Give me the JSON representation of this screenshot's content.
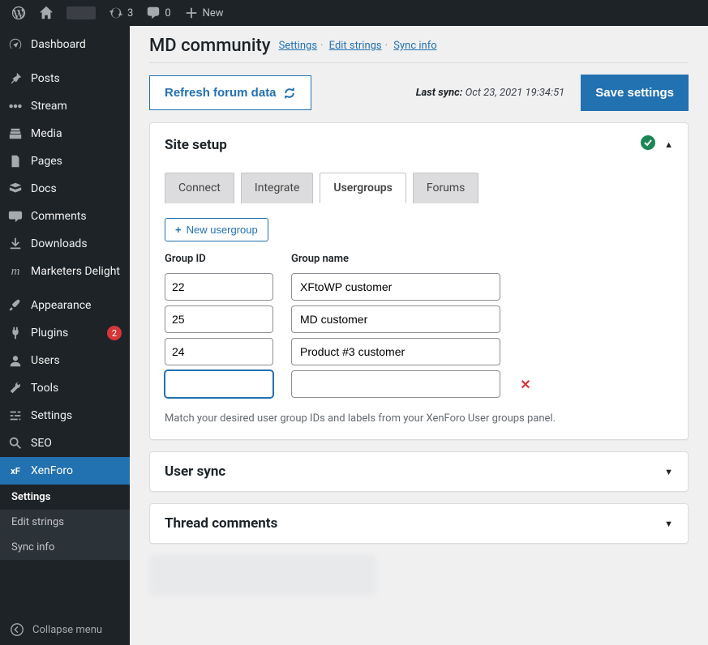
{
  "adminbar": {
    "update_count": "3",
    "comments_count": "0",
    "new_label": "New"
  },
  "sidebar": {
    "items": [
      {
        "label": "Dashboard"
      },
      {
        "label": "Posts"
      },
      {
        "label": "Stream"
      },
      {
        "label": "Media"
      },
      {
        "label": "Pages"
      },
      {
        "label": "Docs"
      },
      {
        "label": "Comments"
      },
      {
        "label": "Downloads"
      },
      {
        "label": "Marketers Delight"
      },
      {
        "label": "Appearance"
      },
      {
        "label": "Plugins",
        "badge": "2"
      },
      {
        "label": "Users"
      },
      {
        "label": "Tools"
      },
      {
        "label": "Settings"
      },
      {
        "label": "SEO"
      },
      {
        "label": "XenForo"
      }
    ],
    "submenu": [
      "Settings",
      "Edit strings",
      "Sync info"
    ],
    "collapse": "Collapse menu"
  },
  "header": {
    "title": "MD community",
    "tabs": [
      "Settings",
      "Edit strings",
      "Sync info"
    ]
  },
  "toolbar": {
    "refresh": "Refresh forum data",
    "last_sync_label": "Last sync:",
    "last_sync_value": "Oct 23, 2021 19:34:51",
    "save": "Save settings"
  },
  "panels": {
    "site_setup": {
      "title": "Site setup",
      "tabs": [
        "Connect",
        "Integrate",
        "Usergroups",
        "Forums"
      ],
      "new_usergroup": "New usergroup",
      "col_id": "Group ID",
      "col_name": "Group name",
      "rows": [
        {
          "id": "22",
          "name": "XFtoWP customer"
        },
        {
          "id": "25",
          "name": "MD customer"
        },
        {
          "id": "24",
          "name": "Product #3 customer"
        },
        {
          "id": "",
          "name": ""
        }
      ],
      "hint": "Match your desired user group IDs and labels from your XenForo User groups panel."
    },
    "user_sync": {
      "title": "User sync"
    },
    "thread_comments": {
      "title": "Thread comments"
    }
  }
}
